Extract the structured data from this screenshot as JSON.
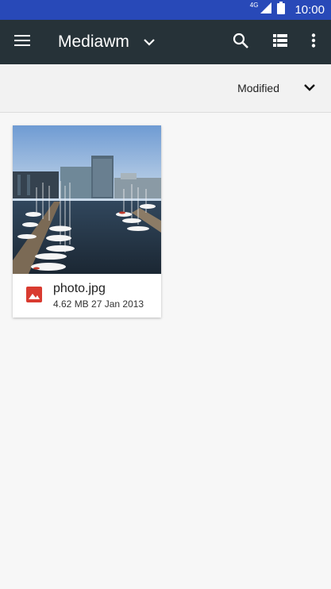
{
  "status_bar": {
    "network": "4G",
    "time": "10:00",
    "icons": [
      "signal-icon",
      "battery-icon"
    ]
  },
  "toolbar": {
    "title": "Mediawm",
    "icons": [
      "menu-icon",
      "chevron-down-icon",
      "search-icon",
      "list-view-icon",
      "more-vert-icon"
    ]
  },
  "sort": {
    "label": "Modified",
    "icon": "chevron-down-icon"
  },
  "files": [
    {
      "name": "photo.jpg",
      "size": "4.62 MB",
      "date": "27 Jan 2013",
      "icon": "image-icon",
      "colors": {
        "icon": "#d93b30"
      }
    }
  ],
  "colors": {
    "status_bar": "#2849b8",
    "toolbar": "#263238",
    "background": "#f7f7f7"
  }
}
